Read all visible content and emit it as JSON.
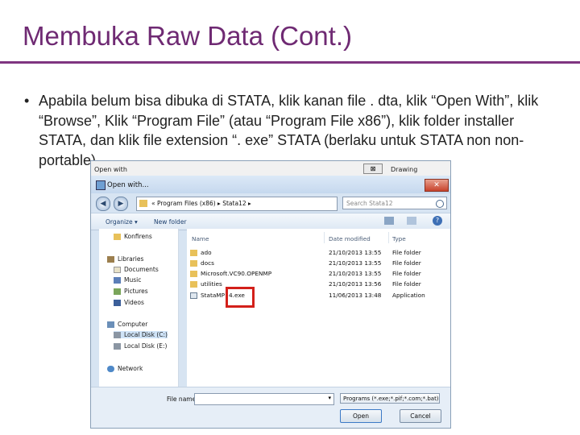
{
  "slide": {
    "title": "Membuka Raw Data (Cont.)",
    "bullet_symbol": "•",
    "bullet_text": "Apabila belum bisa dibuka di STATA, klik kanan file . dta, klik “Open With”, klik “Browse”, Klik “Program File” (atau “Program File x86”), klik folder installer STATA, dan klik file extension “. exe” STATA (berlaku untuk STATA non non-portable)"
  },
  "background_window": {
    "title": "Open with",
    "close_glyph": "⊠",
    "right_text": "Drawing"
  },
  "dialog": {
    "title": "Open with...",
    "title_blur": "",
    "close_glyph": "✕",
    "address": {
      "path": "« Program Files (x86) ▸ Stata12 ▸",
      "refresh_glyph": "↻",
      "search_placeholder": "Search Stata12"
    },
    "back_glyph": "◀",
    "forward_glyph": "▶",
    "commands": {
      "organize": "Organize ▾",
      "new_folder": "New folder",
      "help_glyph": "?"
    },
    "nav_items": [
      {
        "label": "Konfirens",
        "icon": "folder-icon"
      },
      {
        "label": "Libraries",
        "icon": "library-icon"
      },
      {
        "label": "Documents",
        "icon": "documents-icon"
      },
      {
        "label": "Music",
        "icon": "music-icon"
      },
      {
        "label": "Pictures",
        "icon": "pictures-icon"
      },
      {
        "label": "Videos",
        "icon": "videos-icon"
      },
      {
        "label": "Computer",
        "icon": "computer-icon"
      },
      {
        "label": "Local Disk (C:)",
        "icon": "disk-icon"
      },
      {
        "label": "Local Disk (E:)",
        "icon": "disk-icon"
      },
      {
        "label": "Network",
        "icon": "network-icon"
      }
    ],
    "columns": [
      "Name",
      "Date modified",
      "Type"
    ],
    "files": [
      {
        "name": "ado",
        "date": "21/10/2013 13:55",
        "type": "File folder",
        "icon": "folder-icon"
      },
      {
        "name": "docs",
        "date": "21/10/2013 13:55",
        "type": "File folder",
        "icon": "folder-icon"
      },
      {
        "name": "Microsoft.VC90.OPENMP",
        "date": "21/10/2013 13:55",
        "type": "File folder",
        "icon": "folder-icon"
      },
      {
        "name": "utilities",
        "date": "21/10/2013 13:56",
        "type": "File folder",
        "icon": "folder-icon"
      },
      {
        "name": "StataMP",
        "name_suffix": "4.exe",
        "date": "11/06/2013 13:48",
        "type": "Application",
        "icon": "application-icon"
      }
    ],
    "file_name_label": "File name:",
    "file_name_value": "",
    "file_type_value": "Programs (*.exe;*.pif;*.com;*.bat)",
    "dropdown_glyph": "▾",
    "open_label": "Open",
    "cancel_label": "Cancel"
  }
}
